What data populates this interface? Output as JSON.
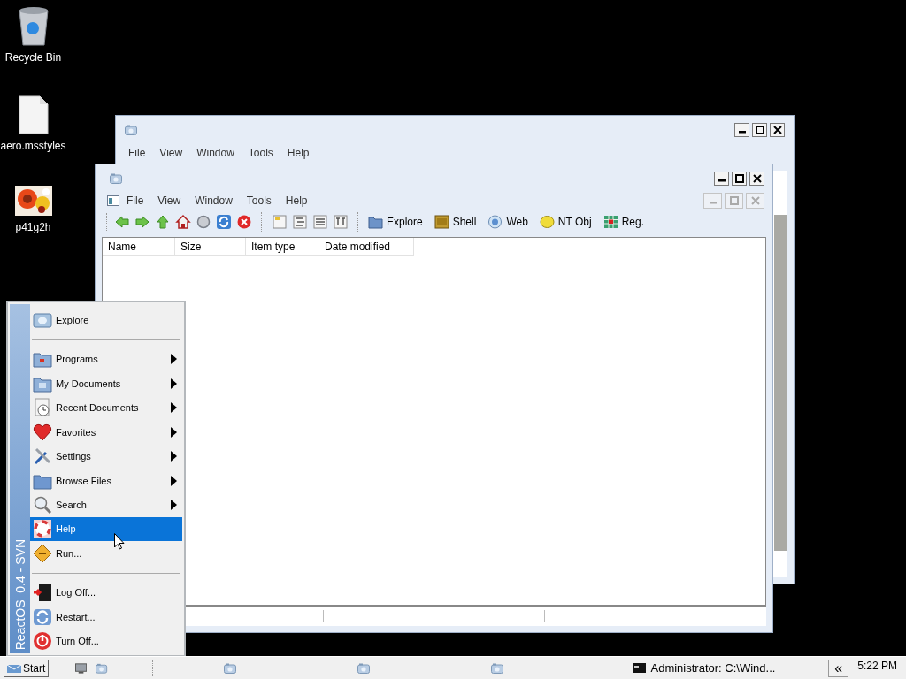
{
  "desktop_icons": [
    {
      "label": "Recycle Bin",
      "kind": "recycle"
    },
    {
      "label": "aero.msstyles",
      "kind": "file"
    },
    {
      "label": "p41g2h",
      "kind": "picture"
    }
  ],
  "back_window": {
    "menu": [
      "File",
      "View",
      "Window",
      "Tools",
      "Help"
    ]
  },
  "front_window": {
    "menu": [
      "File",
      "View",
      "Window",
      "Tools",
      "Help"
    ],
    "tools": [
      {
        "kind": "back"
      },
      {
        "kind": "forward"
      },
      {
        "kind": "up"
      },
      {
        "kind": "home"
      },
      {
        "kind": "search"
      },
      {
        "kind": "refresh"
      },
      {
        "kind": "stop"
      },
      {
        "kind": "sep"
      },
      {
        "kind": "view1"
      },
      {
        "kind": "view2"
      },
      {
        "kind": "view3"
      },
      {
        "kind": "view4"
      },
      {
        "kind": "sep"
      }
    ],
    "drives": [
      {
        "label": "Explore",
        "kind": "folder"
      },
      {
        "label": "Shell",
        "kind": "box"
      },
      {
        "label": "Web",
        "kind": "globe"
      },
      {
        "label": "NT Obj",
        "kind": "coin"
      },
      {
        "label": "Reg.",
        "kind": "grid"
      }
    ],
    "columns": [
      "Name",
      "Size",
      "Item type",
      "Date modified"
    ]
  },
  "start_menu": {
    "banner": "ReactOS  0.4 - SVN",
    "groups": [
      [
        {
          "label": "Explore",
          "kind": "explore",
          "submenu": false,
          "selected": false
        }
      ],
      [
        {
          "label": "Programs",
          "kind": "programs",
          "submenu": true,
          "selected": false
        },
        {
          "label": "My Documents",
          "kind": "documents",
          "submenu": true,
          "selected": false
        },
        {
          "label": "Recent Documents",
          "kind": "recent",
          "submenu": true,
          "selected": false
        },
        {
          "label": "Favorites",
          "kind": "favorites",
          "submenu": true,
          "selected": false
        },
        {
          "label": "Settings",
          "kind": "settings",
          "submenu": true,
          "selected": false
        },
        {
          "label": "Browse Files",
          "kind": "browse",
          "submenu": true,
          "selected": false
        },
        {
          "label": "Search",
          "kind": "search",
          "submenu": true,
          "selected": false
        },
        {
          "label": "Help",
          "kind": "help",
          "submenu": false,
          "selected": true
        },
        {
          "label": "Run...",
          "kind": "run",
          "submenu": false,
          "selected": false
        }
      ],
      [
        {
          "label": "Log Off...",
          "kind": "logoff",
          "submenu": false,
          "selected": false
        },
        {
          "label": "Restart...",
          "kind": "restart",
          "submenu": false,
          "selected": false
        },
        {
          "label": "Turn Off...",
          "kind": "turnoff",
          "submenu": false,
          "selected": false
        }
      ]
    ]
  },
  "taskbar": {
    "start": "Start",
    "tray_task": "Administrator: C:\\Wind...",
    "tray_toggle": "«",
    "clock": "5:22 PM"
  }
}
